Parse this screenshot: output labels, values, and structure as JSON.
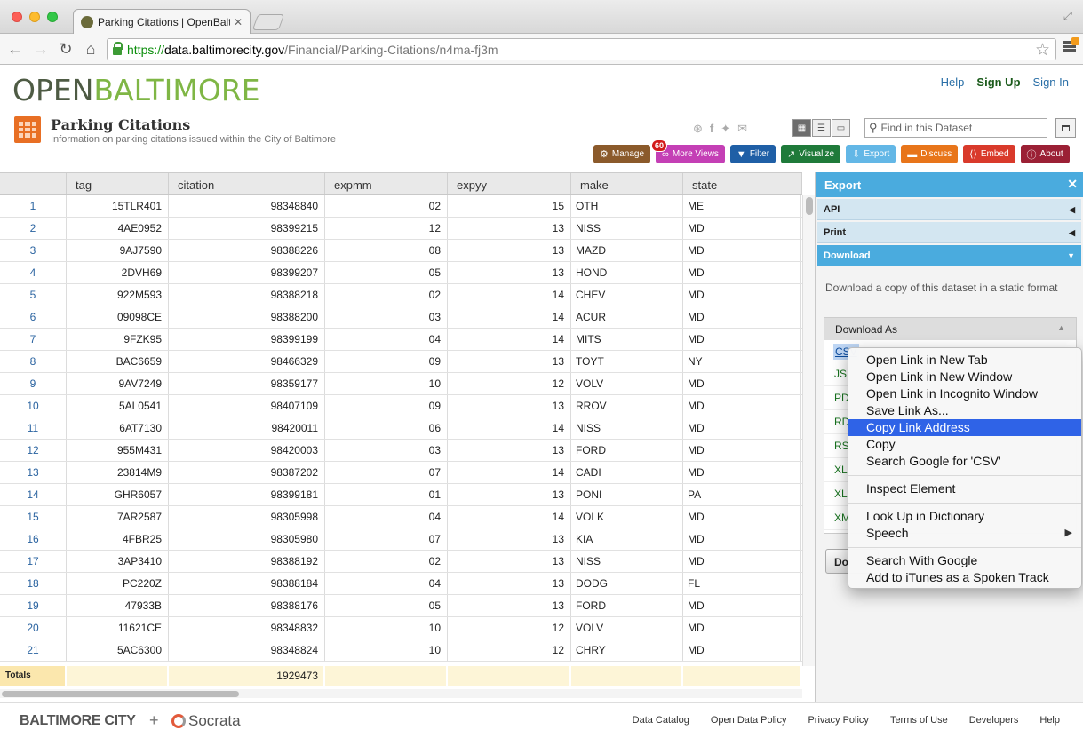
{
  "browser": {
    "tab_title": "Parking Citations | OpenBalti",
    "url_scheme": "https://",
    "url_host": "data.baltimorecity.gov",
    "url_path": "/Financial/Parking-Citations/n4ma-fj3m"
  },
  "site": {
    "logo_open": "OPEN",
    "logo_baltimore": "BALTIMORE",
    "links": {
      "help": "Help",
      "signup": "Sign Up",
      "signin": "Sign In"
    }
  },
  "dataset": {
    "title": "Parking Citations",
    "subtitle": "Information on parking citations issued within the City of Baltimore",
    "find_placeholder": "Find in this Dataset"
  },
  "actions": [
    {
      "label": "Manage",
      "icon": "⚙",
      "color": "#8b5a2b"
    },
    {
      "label": "More Views",
      "icon": "∞",
      "color": "#c43fb5",
      "badge": "60"
    },
    {
      "label": "Filter",
      "icon": "▼",
      "color": "#1f5fa6"
    },
    {
      "label": "Visualize",
      "icon": "↗",
      "color": "#1f7a3a"
    },
    {
      "label": "Export",
      "icon": "⇩",
      "color": "#63b7e6"
    },
    {
      "label": "Discuss",
      "icon": "▬",
      "color": "#e8751a"
    },
    {
      "label": "Embed",
      "icon": "⟨⟩",
      "color": "#d93a2b"
    },
    {
      "label": "About",
      "icon": "ⓘ",
      "color": "#9b2035"
    }
  ],
  "grid": {
    "columns": [
      "tag",
      "citation",
      "expmm",
      "expyy",
      "make",
      "state"
    ],
    "rows": [
      [
        "1",
        "15TLR401",
        "98348840",
        "02",
        "15",
        "OTH",
        "ME"
      ],
      [
        "2",
        "4AE0952",
        "98399215",
        "12",
        "13",
        "NISS",
        "MD"
      ],
      [
        "3",
        "9AJ7590",
        "98388226",
        "08",
        "13",
        "MAZD",
        "MD"
      ],
      [
        "4",
        "2DVH69",
        "98399207",
        "05",
        "13",
        "HOND",
        "MD"
      ],
      [
        "5",
        "922M593",
        "98388218",
        "02",
        "14",
        "CHEV",
        "MD"
      ],
      [
        "6",
        "09098CE",
        "98388200",
        "03",
        "14",
        "ACUR",
        "MD"
      ],
      [
        "7",
        "9FZK95",
        "98399199",
        "04",
        "14",
        "MITS",
        "MD"
      ],
      [
        "8",
        "BAC6659",
        "98466329",
        "09",
        "13",
        "TOYT",
        "NY"
      ],
      [
        "9",
        "9AV7249",
        "98359177",
        "10",
        "12",
        "VOLV",
        "MD"
      ],
      [
        "10",
        "5AL0541",
        "98407109",
        "09",
        "13",
        "RROV",
        "MD"
      ],
      [
        "11",
        "6AT7130",
        "98420011",
        "06",
        "14",
        "NISS",
        "MD"
      ],
      [
        "12",
        "955M431",
        "98420003",
        "03",
        "13",
        "FORD",
        "MD"
      ],
      [
        "13",
        "23814M9",
        "98387202",
        "07",
        "14",
        "CADI",
        "MD"
      ],
      [
        "14",
        "GHR6057",
        "98399181",
        "01",
        "13",
        "PONI",
        "PA"
      ],
      [
        "15",
        "7AR2587",
        "98305998",
        "04",
        "14",
        "VOLK",
        "MD"
      ],
      [
        "16",
        "4FBR25",
        "98305980",
        "07",
        "13",
        "KIA",
        "MD"
      ],
      [
        "17",
        "3AP3410",
        "98388192",
        "02",
        "13",
        "NISS",
        "MD"
      ],
      [
        "18",
        "PC220Z",
        "98388184",
        "04",
        "13",
        "DODG",
        "FL"
      ],
      [
        "19",
        "47933B",
        "98388176",
        "05",
        "13",
        "FORD",
        "MD"
      ],
      [
        "20",
        "11621CE",
        "98348832",
        "10",
        "12",
        "VOLV",
        "MD"
      ],
      [
        "21",
        "5AC6300",
        "98348824",
        "10",
        "12",
        "CHRY",
        "MD"
      ]
    ],
    "totals_label": "Totals",
    "totals_citation": "1929473"
  },
  "panel": {
    "title": "Export",
    "sections": [
      "API",
      "Print",
      "Download"
    ],
    "download_desc": "Download a copy of this dataset in a static format",
    "download_as": "Download As",
    "formats": [
      "CSV",
      "JS",
      "PD",
      "RD",
      "RS",
      "XL",
      "XL",
      "XM"
    ],
    "download_button": "Do"
  },
  "context_menu": {
    "groups": [
      [
        "Open Link in New Tab",
        "Open Link in New Window",
        "Open Link in Incognito Window",
        "Save Link As...",
        "Copy Link Address",
        "Copy",
        "Search Google for 'CSV'"
      ],
      [
        "Inspect Element"
      ],
      [
        "Look Up in Dictionary",
        "Speech"
      ],
      [
        "Search With Google",
        "Add to iTunes as a Spoken Track"
      ]
    ],
    "highlighted": "Copy Link Address"
  },
  "footer": {
    "brand": "BALTIMORE CITY",
    "plus": "+",
    "socrata": "Socrata",
    "links": [
      "Data Catalog",
      "Open Data Policy",
      "Privacy Policy",
      "Terms of Use",
      "Developers",
      "Help"
    ]
  }
}
